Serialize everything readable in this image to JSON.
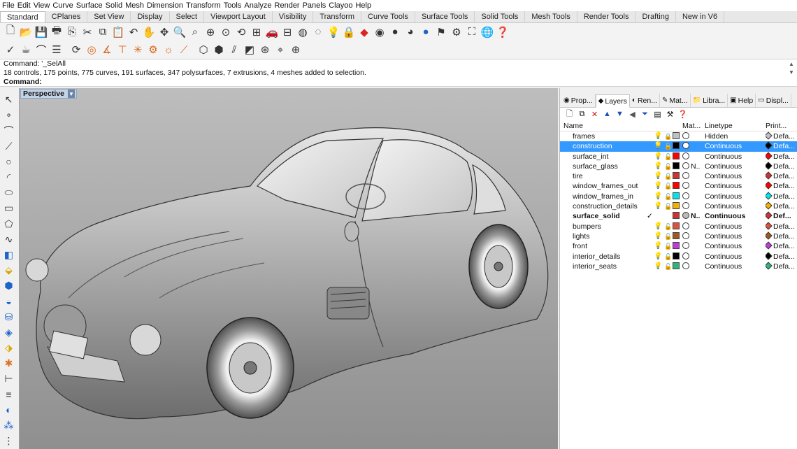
{
  "menu": [
    "File",
    "Edit",
    "View",
    "Curve",
    "Surface",
    "Solid",
    "Mesh",
    "Dimension",
    "Transform",
    "Tools",
    "Analyze",
    "Render",
    "Panels",
    "Clayoo",
    "Help"
  ],
  "toolbar_tabs": [
    {
      "label": "Standard",
      "active": true
    },
    {
      "label": "CPlanes",
      "active": false
    },
    {
      "label": "Set View",
      "active": false
    },
    {
      "label": "Display",
      "active": false
    },
    {
      "label": "Select",
      "active": false
    },
    {
      "label": "Viewport Layout",
      "active": false
    },
    {
      "label": "Visibility",
      "active": false
    },
    {
      "label": "Transform",
      "active": false
    },
    {
      "label": "Curve Tools",
      "active": false
    },
    {
      "label": "Surface Tools",
      "active": false
    },
    {
      "label": "Solid Tools",
      "active": false
    },
    {
      "label": "Mesh Tools",
      "active": false
    },
    {
      "label": "Render Tools",
      "active": false
    },
    {
      "label": "Drafting",
      "active": false
    },
    {
      "label": "New in V6",
      "active": false
    }
  ],
  "command": {
    "history": [
      "Command: '_SelAll",
      "18 controls, 175 points, 775 curves, 191 surfaces, 347 polysurfaces, 7 extrusions, 4 meshes added to selection."
    ],
    "prompt": "Command:",
    "input_value": ""
  },
  "viewport": {
    "title": "Perspective"
  },
  "panel": {
    "tabs": [
      {
        "label": "Prop...",
        "icon": "properties-icon",
        "active": false
      },
      {
        "label": "Layers",
        "icon": "layers-icon",
        "active": true
      },
      {
        "label": "Ren...",
        "icon": "render-icon",
        "active": false
      },
      {
        "label": "Mat...",
        "icon": "materials-icon",
        "active": false
      },
      {
        "label": "Libra...",
        "icon": "libraries-icon",
        "active": false
      },
      {
        "label": "Help",
        "icon": "help-icon",
        "active": false
      },
      {
        "label": "Displ...",
        "icon": "display-icon",
        "active": false
      }
    ]
  },
  "layers": {
    "columns": {
      "name": "Name",
      "material": "Mat...",
      "linetype": "Linetype",
      "print": "Print..."
    },
    "rows": [
      {
        "name": "frames",
        "color": "#c0c0c0",
        "linetype": "Hidden",
        "print_color": "#c0c0c0",
        "print": "Defa...",
        "locked": true,
        "material": ""
      },
      {
        "name": "construction",
        "color": "#000000",
        "linetype": "Continuous",
        "print_color": "#000000",
        "print": "Defa...",
        "locked": false,
        "selected": true,
        "material": ""
      },
      {
        "name": "surface_int",
        "color": "#ff0000",
        "linetype": "Continuous",
        "print_color": "#ff0000",
        "print": "Defa...",
        "locked": false,
        "material": ""
      },
      {
        "name": "surface_glass",
        "color": "#000000",
        "linetype": "Continuous",
        "print_color": "#000000",
        "print": "Defa...",
        "locked": false,
        "material": "N..."
      },
      {
        "name": "tire",
        "color": "#cc3333",
        "linetype": "Continuous",
        "print_color": "#cc3333",
        "print": "Defa...",
        "locked": false,
        "material": ""
      },
      {
        "name": "window_frames_out",
        "color": "#ff0000",
        "linetype": "Continuous",
        "print_color": "#ff0000",
        "print": "Defa...",
        "locked": false,
        "material": ""
      },
      {
        "name": "window_frames_in",
        "color": "#00e5ee",
        "linetype": "Continuous",
        "print_color": "#00e5ee",
        "print": "Defa...",
        "locked": false,
        "material": ""
      },
      {
        "name": "construction_details",
        "color": "#f2b000",
        "linetype": "Continuous",
        "print_color": "#f2b000",
        "print": "Defa...",
        "locked": false,
        "material": ""
      },
      {
        "name": "surface_solid",
        "color": "#cc3333",
        "linetype": "Continuous",
        "print_color": "#cc3333",
        "print": "Def...",
        "locked": false,
        "current": true,
        "material": "N..."
      },
      {
        "name": "bumpers",
        "color": "#d9533f",
        "linetype": "Continuous",
        "print_color": "#d9533f",
        "print": "Defa...",
        "locked": false,
        "material": ""
      },
      {
        "name": "lights",
        "color": "#a0581c",
        "linetype": "Continuous",
        "print_color": "#a0581c",
        "print": "Defa...",
        "locked": false,
        "material": ""
      },
      {
        "name": "front",
        "color": "#c03adb",
        "linetype": "Continuous",
        "print_color": "#c03adb",
        "print": "Defa...",
        "locked": false,
        "material": ""
      },
      {
        "name": "interior_details",
        "color": "#000000",
        "linetype": "Continuous",
        "print_color": "#000000",
        "print": "Defa...",
        "locked": false,
        "material": ""
      },
      {
        "name": "interior_seats",
        "color": "#2fb57a",
        "linetype": "Continuous",
        "print_color": "#2fb57a",
        "print": "Defa...",
        "locked": false,
        "material": ""
      }
    ]
  },
  "colors": {
    "selection": "#3399ff",
    "viewport_title_bg": "#c3d3e6"
  }
}
